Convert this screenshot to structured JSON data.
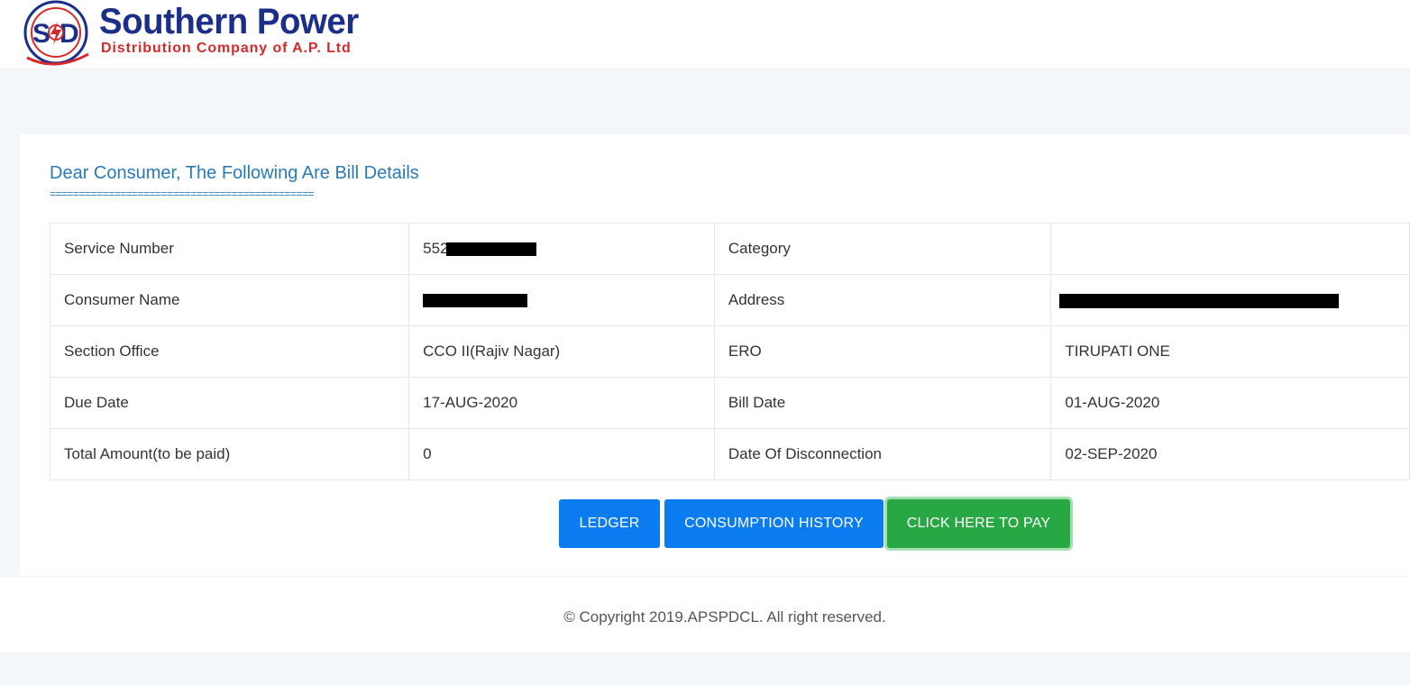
{
  "brand": {
    "title": "Southern Power",
    "subtitle": "Distribution Company of A.P. Ltd",
    "logo_letters": "SPD",
    "colors": {
      "navy": "#1b2f8a",
      "red": "#d62a2a"
    }
  },
  "card": {
    "heading": "Dear Consumer, The Following Are Bill Details",
    "underline": "=============================================",
    "rows": [
      {
        "label1": "Service Number",
        "value1": "552",
        "label2": "Category",
        "value2": ""
      },
      {
        "label1": "Consumer Name",
        "value1": "",
        "label2": "Address",
        "value2": ""
      },
      {
        "label1": "Section Office",
        "value1": "CCO II(Rajiv Nagar)",
        "label2": "ERO",
        "value2": "TIRUPATI ONE"
      },
      {
        "label1": "Due Date",
        "value1": "17-AUG-2020",
        "label2": "Bill Date",
        "value2": "01-AUG-2020"
      },
      {
        "label1": "Total Amount(to be paid)",
        "value1": "0",
        "label2": "Date Of Disconnection",
        "value2": "02-SEP-2020"
      }
    ]
  },
  "buttons": {
    "ledger": "LEDGER",
    "history": "CONSUMPTION HISTORY",
    "pay": "CLICK HERE TO PAY",
    "colors": {
      "blue": "#0a7cf0",
      "green": "#28a745"
    }
  },
  "footer": {
    "text": "© Copyright 2019.APSPDCL. All right reserved."
  }
}
